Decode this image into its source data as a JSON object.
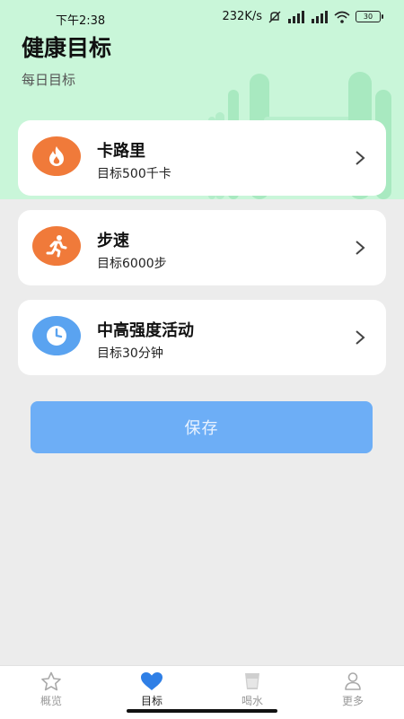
{
  "status_bar": {
    "time": "下午2:38",
    "network_speed": "232K/s",
    "battery": "30"
  },
  "header": {
    "title": "健康目标",
    "subtitle": "每日目标"
  },
  "goals": [
    {
      "title": "卡路里",
      "subtitle": "目标500千卡",
      "icon": "flame-icon",
      "icon_color": "#f07a3a"
    },
    {
      "title": "步速",
      "subtitle": "目标6000步",
      "icon": "running-person-icon",
      "icon_color": "#f07a3a"
    },
    {
      "title": "中高强度活动",
      "subtitle": "目标30分钟",
      "icon": "clock-icon",
      "icon_color": "#5aa3f0"
    }
  ],
  "save_button": {
    "label": "保存",
    "color": "#6daef6"
  },
  "tabs": [
    {
      "label": "概览",
      "icon": "star-icon",
      "active": false
    },
    {
      "label": "目标",
      "icon": "heart-icon",
      "active": true
    },
    {
      "label": "喝水",
      "icon": "cup-icon",
      "active": false
    },
    {
      "label": "更多",
      "icon": "person-icon",
      "active": false
    }
  ],
  "colors": {
    "header_bg": "#c9f6d9",
    "page_bg": "#ececec",
    "active_tab": "#2f7fe6"
  }
}
